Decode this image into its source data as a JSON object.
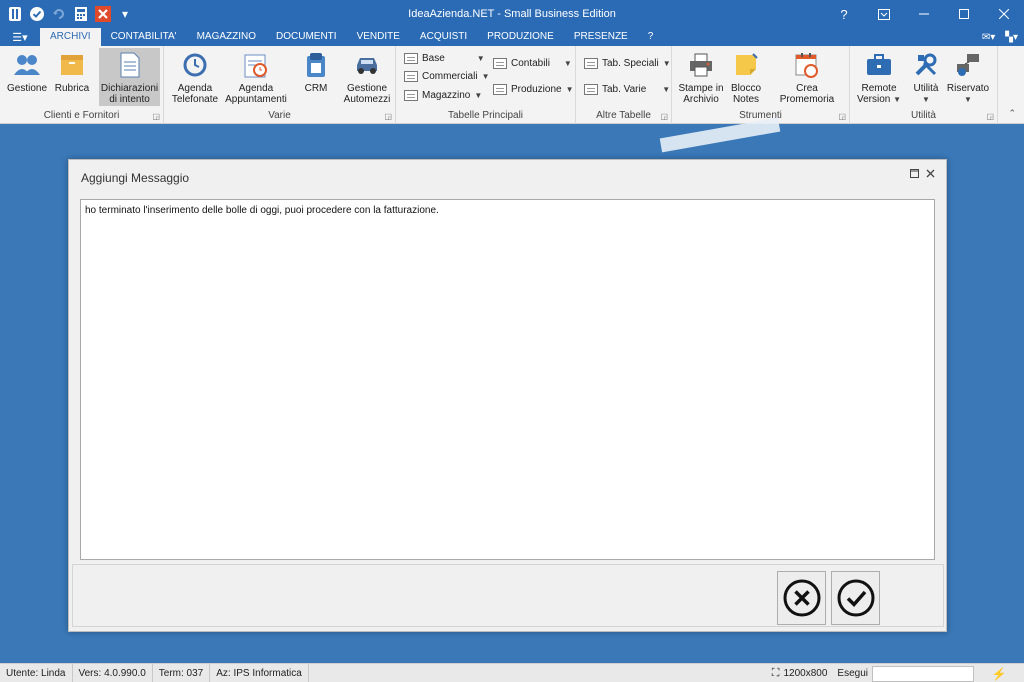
{
  "window": {
    "title": "IdeaAzienda.NET - Small Business Edition",
    "help": "?"
  },
  "tabs": [
    {
      "label": "ARCHIVI",
      "active": true
    },
    {
      "label": "CONTABILITA'"
    },
    {
      "label": "MAGAZZINO"
    },
    {
      "label": "DOCUMENTI"
    },
    {
      "label": "VENDITE"
    },
    {
      "label": "ACQUISTI"
    },
    {
      "label": "PRODUZIONE"
    },
    {
      "label": "PRESENZE"
    },
    {
      "label": "?"
    }
  ],
  "ribbon": {
    "groups": {
      "clienti": "Clienti e Fornitori",
      "varie": "Varie",
      "tabelle": "Tabelle Principali",
      "altre": "Altre Tabelle",
      "strumenti": "Strumenti",
      "utilita": "Utilità"
    },
    "buttons": {
      "gestione": "Gestione",
      "rubrica": "Rubrica",
      "dichiarazioni_1": "Dichiarazioni",
      "dichiarazioni_2": "di intento",
      "agenda_tel_1": "Agenda",
      "agenda_tel_2": "Telefonate",
      "agenda_app_1": "Agenda",
      "agenda_app_2": "Appuntamenti",
      "crm": "CRM",
      "gest_auto_1": "Gestione",
      "gest_auto_2": "Automezzi",
      "base": "Base",
      "commerciali": "Commerciali",
      "magazzino": "Magazzino",
      "contabili": "Contabili",
      "produzione": "Produzione",
      "tab_speciali": "Tab. Speciali",
      "tab_varie": "Tab. Varie",
      "stampe_1": "Stampe in",
      "stampe_2": "Archivio",
      "blocco_1": "Blocco",
      "blocco_2": "Notes",
      "promemoria": "Crea Promemoria",
      "remote_1": "Remote",
      "remote_2": "Version",
      "utilita": "Utilità",
      "riservato": "Riservato"
    }
  },
  "dialog": {
    "title": "Aggiungi Messaggio",
    "message": "ho terminato l'inserimento delle bolle di oggi, puoi procedere con la fatturazione."
  },
  "statusbar": {
    "utente": "Utente: Linda",
    "versione": "Vers: 4.0.990.0",
    "terminale": "Term: 037",
    "azienda": "Az: IPS Informatica",
    "risoluzione": "1200x800",
    "esegui": "Esegui"
  },
  "colors": {
    "accent": "#2b6bb5",
    "background": "#3a78b8",
    "close_icon": "#e04a2a"
  }
}
